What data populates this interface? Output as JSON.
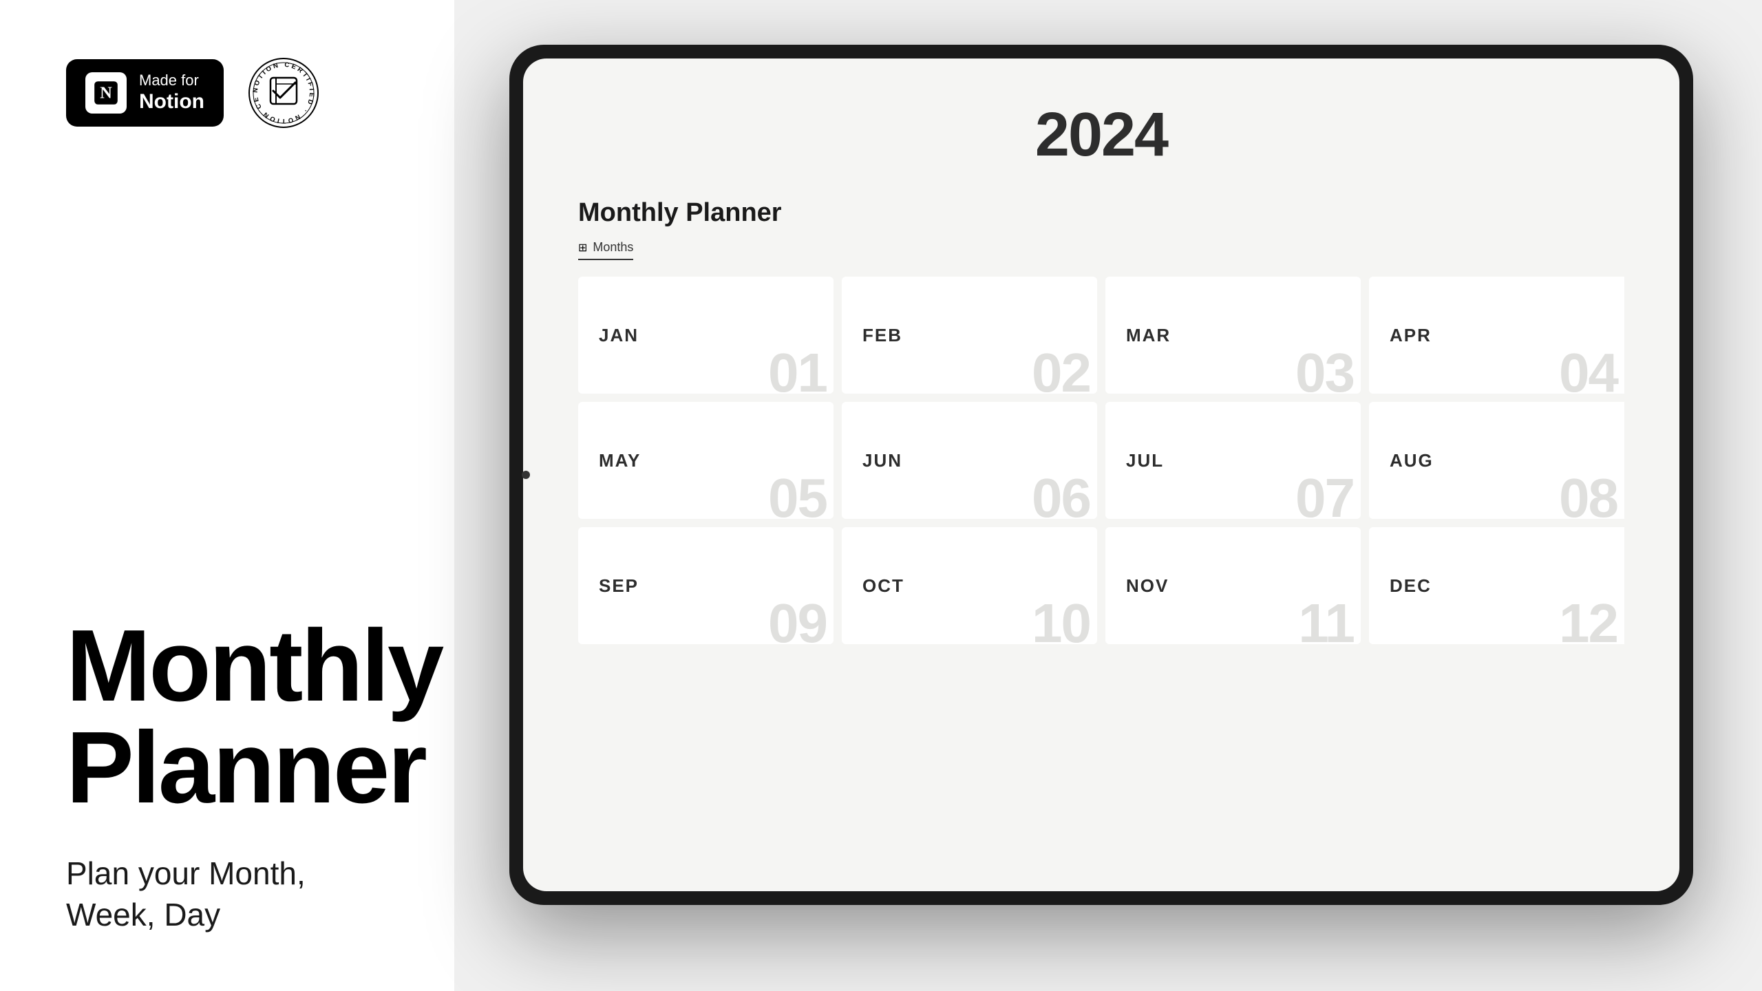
{
  "left": {
    "badge": {
      "made_for": "Made for",
      "notion": "Notion"
    },
    "certified_text": "NOTION CERTIFIED",
    "title_line1": "Monthly",
    "title_line2": "Planner",
    "subtitle": "Plan your Month,\nWeek, Day"
  },
  "tablet": {
    "year": "2024",
    "planner_title": "Monthly Planner",
    "tab_label": "Months",
    "months": [
      {
        "name": "JAN",
        "number": "01"
      },
      {
        "name": "FEB",
        "number": "02"
      },
      {
        "name": "MAR",
        "number": "03"
      },
      {
        "name": "APR",
        "number": "04"
      },
      {
        "name": "MAY",
        "number": "05"
      },
      {
        "name": "JUN",
        "number": "06"
      },
      {
        "name": "JUL",
        "number": "07"
      },
      {
        "name": "AUG",
        "number": "08"
      },
      {
        "name": "SEP",
        "number": "09"
      },
      {
        "name": "OCT",
        "number": "10"
      },
      {
        "name": "NOV",
        "number": "11"
      },
      {
        "name": "DEC",
        "number": "12"
      }
    ]
  }
}
